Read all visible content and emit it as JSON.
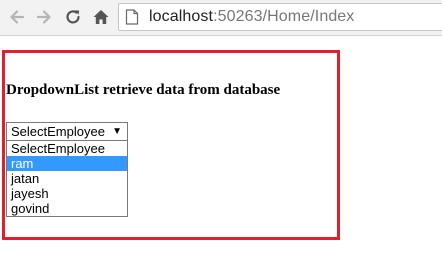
{
  "browser": {
    "url_host": "localhost",
    "url_rest": ":50263/Home/Index",
    "icons": {
      "back": "arrow-left-icon",
      "forward": "arrow-right-icon",
      "reload": "reload-icon",
      "home": "home-icon",
      "page": "page-icon"
    }
  },
  "page": {
    "heading": "DropdownList retrieve data from database",
    "highlight_color": "#e0202a"
  },
  "dropdown": {
    "selected_value": "SelectEmployee",
    "arrow": "▼",
    "highlighted_option": "ram",
    "highlight_color": "#3399ff",
    "options": [
      "SelectEmployee",
      "ram",
      "jatan",
      "jayesh",
      "govind"
    ]
  }
}
